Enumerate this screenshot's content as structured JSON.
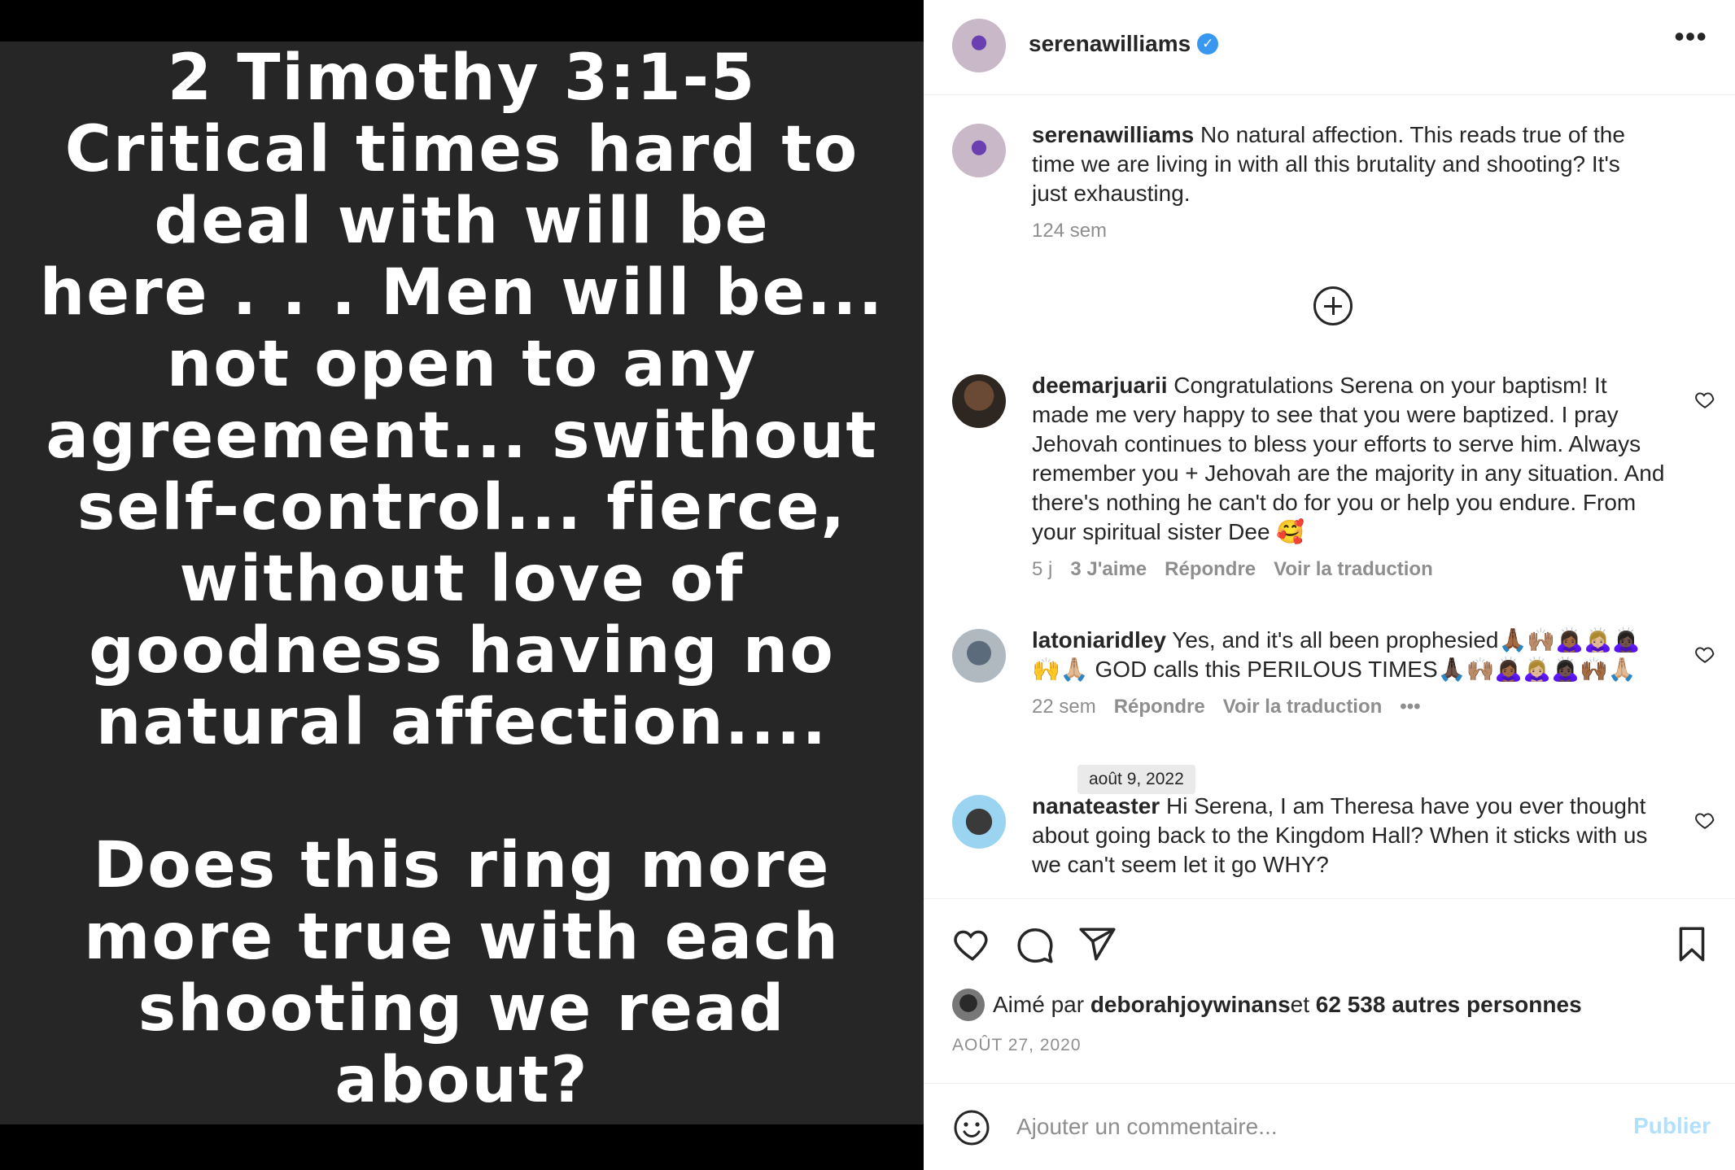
{
  "media": {
    "text": "2 Timothy 3:1-5\nCritical times hard to\ndeal with will be\nhere . . . Men will be...\nnot open to any\nagreement... swithout\nself-control... fierce,\nwithout love of\ngoodness having no\nnatural affection....\n\nDoes this ring more\nmore true with each\nshooting we read about?"
  },
  "header": {
    "username": "serenawilliams",
    "verified_mark": "✓",
    "more": "•••"
  },
  "caption": {
    "username": "serenawilliams",
    "text": " No natural affection. This reads true of the time we are living in with all this brutality and shooting? It's just exhausting.",
    "time": "124 sem"
  },
  "comments": [
    {
      "username": "deemarjuarii",
      "text": " Congratulations Serena on your baptism! It made me very happy to see that you were baptized. I pray Jehovah continues to bless your efforts to serve him. Always remember you + Jehovah are the majority in any situation. And there's nothing he can't do for you or help you endure. From your spiritual sister Dee 🥰",
      "time": "5 j",
      "likes": "3 J'aime",
      "reply": "Répondre",
      "translate": "Voir la traduction"
    },
    {
      "username": "latoniaridley",
      "text": " Yes, and it's all been prophesied🙏🏾🙌🏽🙇🏾‍♀️🙇🏼‍♀️🙇🏿‍♀️🙌🙏🏼 GOD calls this PERILOUS TIMES🙏🏿🙌🏽🙇🏾‍♀️🙇🏼‍♀️🙇🏿‍♀️🙌🏾🙏🏼",
      "time": "22 sem",
      "reply": "Répondre",
      "translate": "Voir la traduction",
      "more": "•••"
    },
    {
      "username": "nanateaster",
      "text": " Hi Serena, I am Theresa have you ever thought about going back to the Kingdom Hall? When it sticks with us we can't seem let it go WHY?"
    }
  ],
  "tooltip": "août 9, 2022",
  "likes": {
    "prefix": "Aimé par ",
    "user": "deborahjoywinans",
    "middle": " et ",
    "count": "62 538 autres personnes"
  },
  "post_date": "AOÛT 27, 2020",
  "add_comment": {
    "placeholder": "Ajouter un commentaire...",
    "publish": "Publier"
  },
  "colors": {
    "verified": "#3897f0",
    "publish_disabled": "#b2dffc",
    "media_bg": "#262626"
  }
}
